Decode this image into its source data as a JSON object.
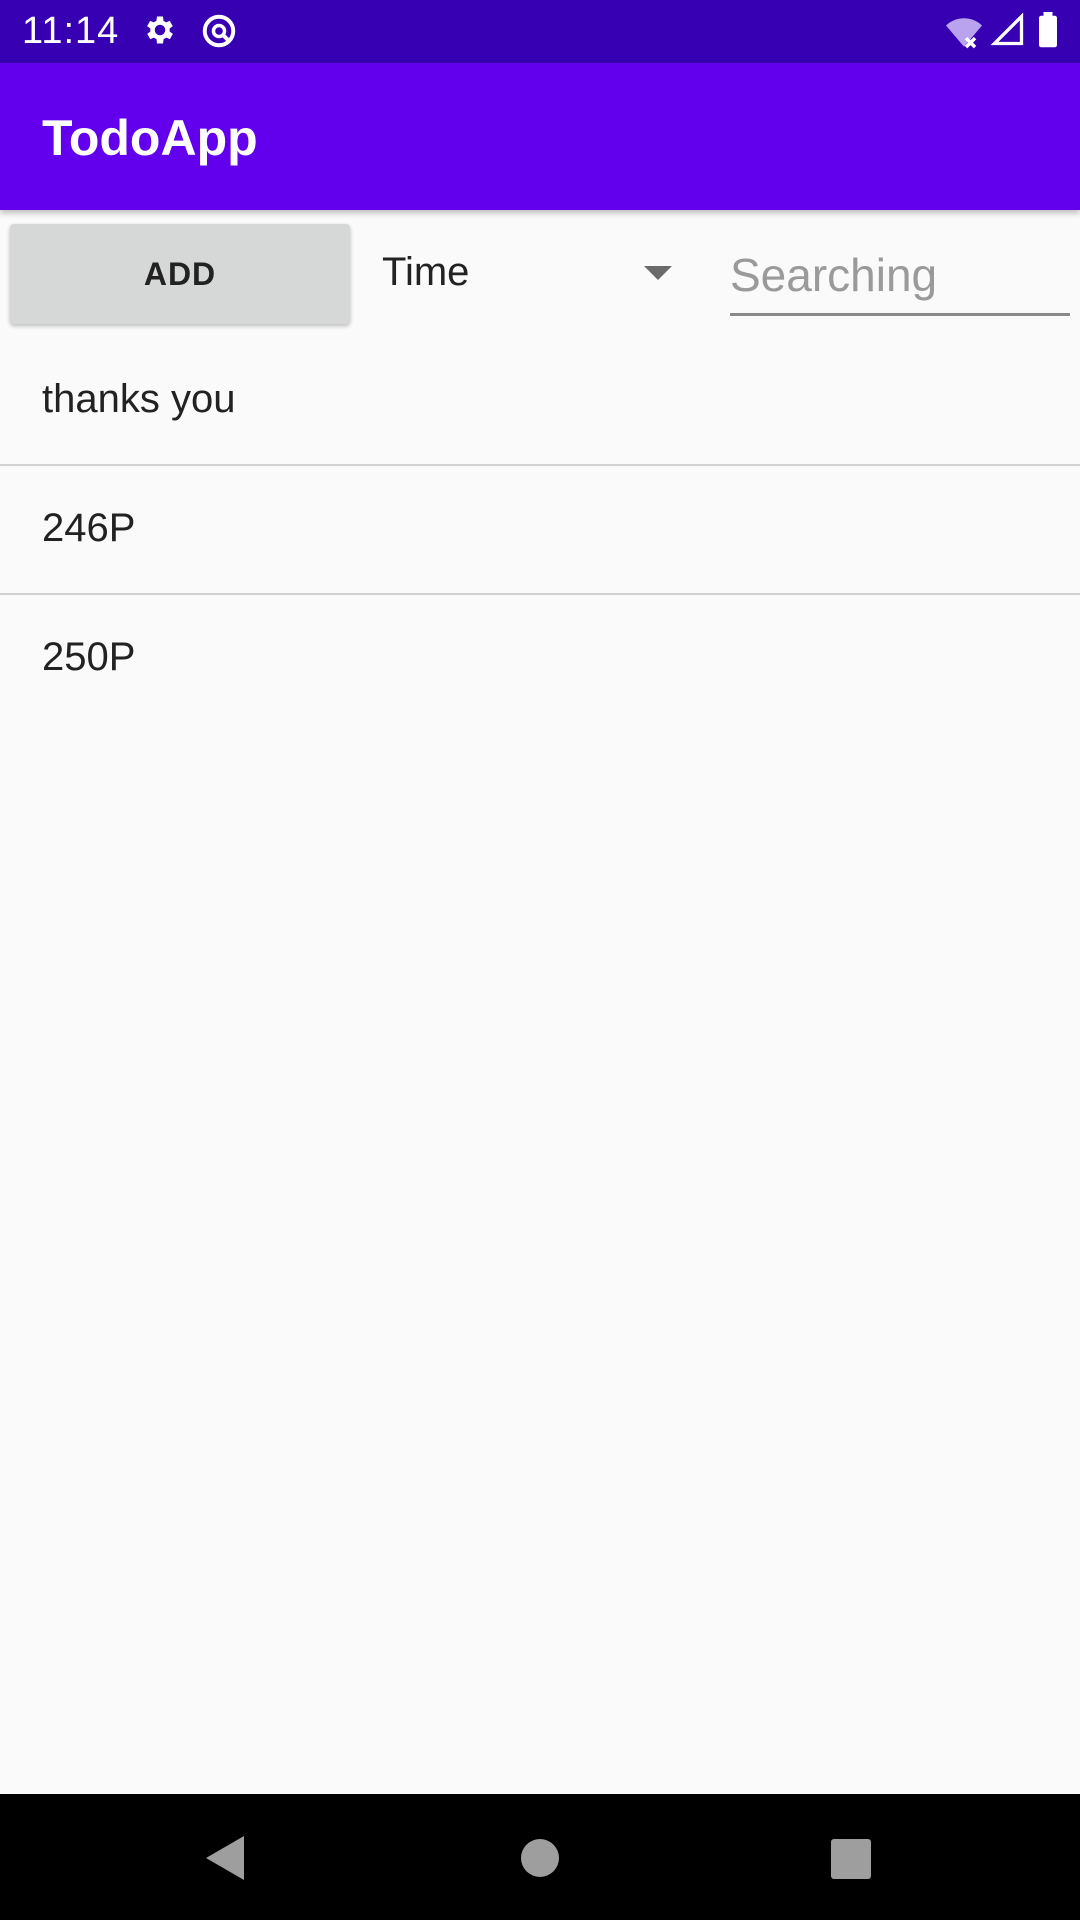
{
  "status_bar": {
    "time": "11:14",
    "icons": [
      "gear-icon",
      "sync-icon",
      "wifi-icon",
      "signal-icon",
      "battery-icon"
    ]
  },
  "app_bar": {
    "title": "TodoApp"
  },
  "controls": {
    "add_label": "ADD",
    "sort_selected": "Time",
    "search_placeholder": "Searching"
  },
  "todos": [
    "thanks you",
    "246P",
    "250P"
  ],
  "nav_bar": {
    "icons": [
      "back-icon",
      "home-icon",
      "recents-icon"
    ]
  },
  "colors": {
    "status_bar": "#3700b3",
    "app_bar": "#6200ee",
    "background": "#fafafa",
    "add_button": "#d6d7d7"
  }
}
